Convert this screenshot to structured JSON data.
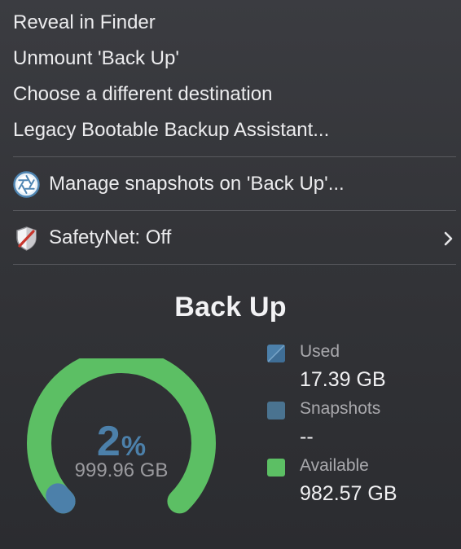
{
  "menu": {
    "items": [
      {
        "label": "Reveal in Finder"
      },
      {
        "label": "Unmount 'Back Up'"
      },
      {
        "label": "Choose a different destination"
      },
      {
        "label": "Legacy Bootable Backup Assistant..."
      }
    ],
    "snapshots_item": {
      "label": "Manage snapshots on 'Back Up'...",
      "icon": "aperture-icon"
    },
    "safetynet_item": {
      "label": "SafetyNet: Off",
      "icon": "shield-off-icon",
      "submenu_icon": "chevron-right-icon"
    }
  },
  "volume": {
    "title": "Back Up",
    "gauge": {
      "percent_value": "2",
      "percent_sign": "%",
      "used_fraction": 0.02,
      "capacity": "999.96 GB"
    },
    "legend": [
      {
        "label": "Used",
        "value": "17.39 GB",
        "color": "#4c80aa",
        "swatch": "striped"
      },
      {
        "label": "Snapshots",
        "value": "--",
        "color": "#4a7390",
        "swatch": "solid"
      },
      {
        "label": "Available",
        "value": "982.57 GB",
        "color": "#5cbf64",
        "swatch": "solid"
      }
    ]
  },
  "colors": {
    "background": "#333438",
    "text": "#ececee",
    "available_green": "#5cbf64",
    "used_blue": "#4c80aa",
    "divider": "#58595e"
  }
}
